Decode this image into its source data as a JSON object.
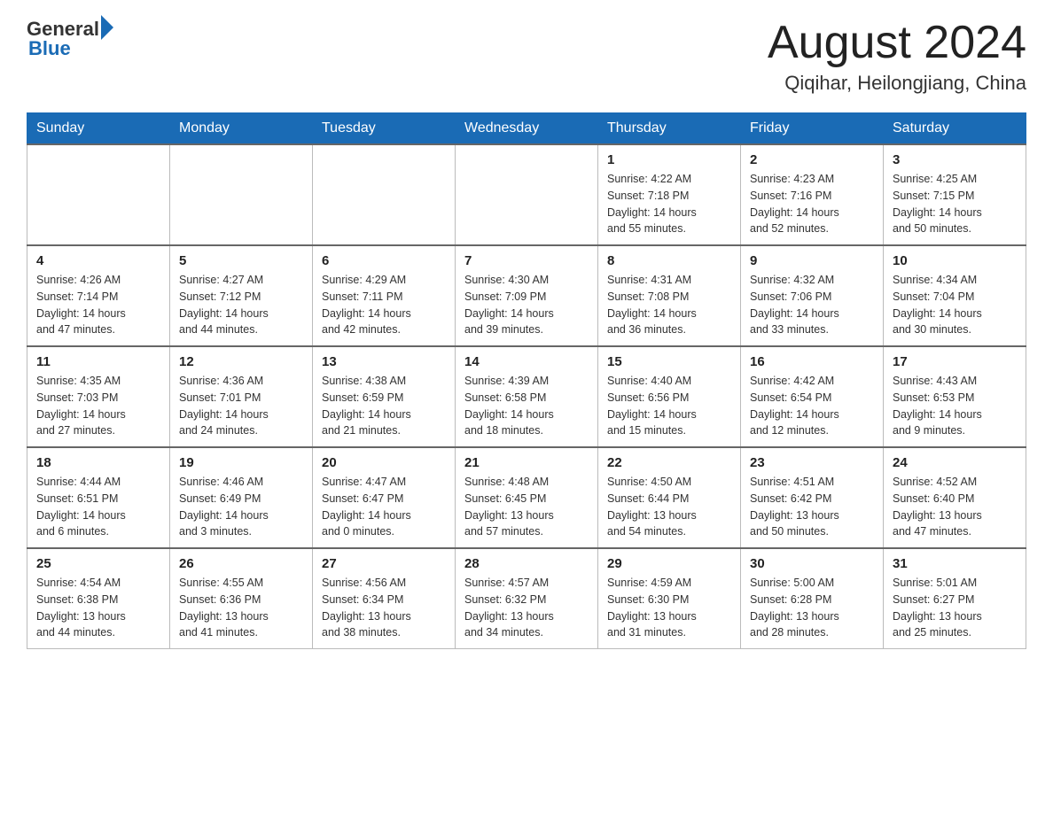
{
  "header": {
    "logo_general": "General",
    "logo_blue": "Blue",
    "month_title": "August 2024",
    "location": "Qiqihar, Heilongjiang, China"
  },
  "weekdays": [
    "Sunday",
    "Monday",
    "Tuesday",
    "Wednesday",
    "Thursday",
    "Friday",
    "Saturday"
  ],
  "weeks": [
    [
      {
        "day": "",
        "info": ""
      },
      {
        "day": "",
        "info": ""
      },
      {
        "day": "",
        "info": ""
      },
      {
        "day": "",
        "info": ""
      },
      {
        "day": "1",
        "info": "Sunrise: 4:22 AM\nSunset: 7:18 PM\nDaylight: 14 hours\nand 55 minutes."
      },
      {
        "day": "2",
        "info": "Sunrise: 4:23 AM\nSunset: 7:16 PM\nDaylight: 14 hours\nand 52 minutes."
      },
      {
        "day": "3",
        "info": "Sunrise: 4:25 AM\nSunset: 7:15 PM\nDaylight: 14 hours\nand 50 minutes."
      }
    ],
    [
      {
        "day": "4",
        "info": "Sunrise: 4:26 AM\nSunset: 7:14 PM\nDaylight: 14 hours\nand 47 minutes."
      },
      {
        "day": "5",
        "info": "Sunrise: 4:27 AM\nSunset: 7:12 PM\nDaylight: 14 hours\nand 44 minutes."
      },
      {
        "day": "6",
        "info": "Sunrise: 4:29 AM\nSunset: 7:11 PM\nDaylight: 14 hours\nand 42 minutes."
      },
      {
        "day": "7",
        "info": "Sunrise: 4:30 AM\nSunset: 7:09 PM\nDaylight: 14 hours\nand 39 minutes."
      },
      {
        "day": "8",
        "info": "Sunrise: 4:31 AM\nSunset: 7:08 PM\nDaylight: 14 hours\nand 36 minutes."
      },
      {
        "day": "9",
        "info": "Sunrise: 4:32 AM\nSunset: 7:06 PM\nDaylight: 14 hours\nand 33 minutes."
      },
      {
        "day": "10",
        "info": "Sunrise: 4:34 AM\nSunset: 7:04 PM\nDaylight: 14 hours\nand 30 minutes."
      }
    ],
    [
      {
        "day": "11",
        "info": "Sunrise: 4:35 AM\nSunset: 7:03 PM\nDaylight: 14 hours\nand 27 minutes."
      },
      {
        "day": "12",
        "info": "Sunrise: 4:36 AM\nSunset: 7:01 PM\nDaylight: 14 hours\nand 24 minutes."
      },
      {
        "day": "13",
        "info": "Sunrise: 4:38 AM\nSunset: 6:59 PM\nDaylight: 14 hours\nand 21 minutes."
      },
      {
        "day": "14",
        "info": "Sunrise: 4:39 AM\nSunset: 6:58 PM\nDaylight: 14 hours\nand 18 minutes."
      },
      {
        "day": "15",
        "info": "Sunrise: 4:40 AM\nSunset: 6:56 PM\nDaylight: 14 hours\nand 15 minutes."
      },
      {
        "day": "16",
        "info": "Sunrise: 4:42 AM\nSunset: 6:54 PM\nDaylight: 14 hours\nand 12 minutes."
      },
      {
        "day": "17",
        "info": "Sunrise: 4:43 AM\nSunset: 6:53 PM\nDaylight: 14 hours\nand 9 minutes."
      }
    ],
    [
      {
        "day": "18",
        "info": "Sunrise: 4:44 AM\nSunset: 6:51 PM\nDaylight: 14 hours\nand 6 minutes."
      },
      {
        "day": "19",
        "info": "Sunrise: 4:46 AM\nSunset: 6:49 PM\nDaylight: 14 hours\nand 3 minutes."
      },
      {
        "day": "20",
        "info": "Sunrise: 4:47 AM\nSunset: 6:47 PM\nDaylight: 14 hours\nand 0 minutes."
      },
      {
        "day": "21",
        "info": "Sunrise: 4:48 AM\nSunset: 6:45 PM\nDaylight: 13 hours\nand 57 minutes."
      },
      {
        "day": "22",
        "info": "Sunrise: 4:50 AM\nSunset: 6:44 PM\nDaylight: 13 hours\nand 54 minutes."
      },
      {
        "day": "23",
        "info": "Sunrise: 4:51 AM\nSunset: 6:42 PM\nDaylight: 13 hours\nand 50 minutes."
      },
      {
        "day": "24",
        "info": "Sunrise: 4:52 AM\nSunset: 6:40 PM\nDaylight: 13 hours\nand 47 minutes."
      }
    ],
    [
      {
        "day": "25",
        "info": "Sunrise: 4:54 AM\nSunset: 6:38 PM\nDaylight: 13 hours\nand 44 minutes."
      },
      {
        "day": "26",
        "info": "Sunrise: 4:55 AM\nSunset: 6:36 PM\nDaylight: 13 hours\nand 41 minutes."
      },
      {
        "day": "27",
        "info": "Sunrise: 4:56 AM\nSunset: 6:34 PM\nDaylight: 13 hours\nand 38 minutes."
      },
      {
        "day": "28",
        "info": "Sunrise: 4:57 AM\nSunset: 6:32 PM\nDaylight: 13 hours\nand 34 minutes."
      },
      {
        "day": "29",
        "info": "Sunrise: 4:59 AM\nSunset: 6:30 PM\nDaylight: 13 hours\nand 31 minutes."
      },
      {
        "day": "30",
        "info": "Sunrise: 5:00 AM\nSunset: 6:28 PM\nDaylight: 13 hours\nand 28 minutes."
      },
      {
        "day": "31",
        "info": "Sunrise: 5:01 AM\nSunset: 6:27 PM\nDaylight: 13 hours\nand 25 minutes."
      }
    ]
  ]
}
